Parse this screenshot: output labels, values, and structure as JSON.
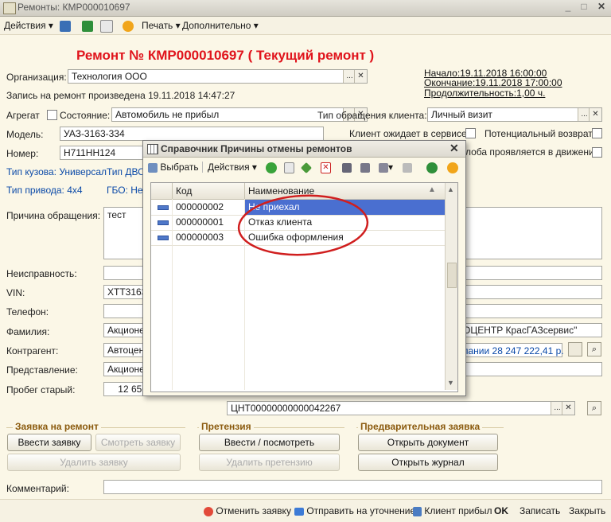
{
  "window": {
    "title": "Ремонты: КМР000010697"
  },
  "toolbar": {
    "actions": "Действия",
    "print": "Печать",
    "more": "Дополнительно"
  },
  "header": {
    "title": "Ремонт № КМР000010697 ( Текущий ремонт )"
  },
  "org": {
    "label": "Организация:",
    "value": "Технология ООО"
  },
  "record_text": "Запись на ремонт произведена 19.11.2018 14:47:27",
  "period": {
    "start": "Начало:19.11.2018 16:00:00",
    "end": "Окончание:19.11.2018 17:00:00",
    "duration": "Продолжительность:1,00 ч."
  },
  "aggregate": {
    "label": "Агрегат",
    "state_label": "Состояние:",
    "state_value": "Автомобиль не прибыл"
  },
  "client_type": {
    "label": "Тип обращения клиента:",
    "value": "Личный визит"
  },
  "model": {
    "label": "Модель:",
    "value": "УАЗ-3163-334"
  },
  "waiting": {
    "label": "Клиент ожидает в сервисе",
    "potential_return": "Потенциальный возврат",
    "in_motion": "лоба проявляется в движении"
  },
  "number": {
    "label": "Номер:",
    "value": "Н711НН124"
  },
  "body_type": "Тип кузова: Универсал",
  "engine_type": "Тип ДВС",
  "drive_type": "Тип привода: 4х4",
  "gbo": "ГБО: Нет",
  "reason": {
    "label": "Причина обращения:",
    "value": "тест"
  },
  "fault": {
    "label": "Неисправность:"
  },
  "vin": {
    "label": "VIN:",
    "value": "XTT3163"
  },
  "phone": {
    "label": "Телефон:"
  },
  "surname": {
    "label": "Фамилия:",
    "value": "Акционер",
    "right_value": "ОЦЕНТР КрасГАЗсервис\""
  },
  "counterparty": {
    "label": "Контрагент:",
    "value": "Автоцент",
    "right_link": "пании 28 247 222,41 р."
  },
  "representation": {
    "label": "Представление:",
    "value": "Акционер"
  },
  "mileage": {
    "label": "Пробег старый:",
    "value": "12 650"
  },
  "code_field": "ЦНТ00000000000042267",
  "groups": {
    "request": {
      "title": "Заявка на ремонт",
      "enter": "Ввести заявку",
      "view": "Смотреть заявку",
      "delete": "Удалить заявку"
    },
    "claim": {
      "title": "Претензия",
      "enter": "Ввести / посмотреть претензию",
      "delete": "Удалить претензию"
    },
    "prelim": {
      "title": "Предварительная заявка",
      "open_doc": "Открыть документ",
      "open_journal": "Открыть журнал"
    }
  },
  "comment": {
    "label": "Комментарий:"
  },
  "bottom": {
    "cancel": "Отменить заявку",
    "send": "Отправить на уточнение",
    "arrived": "Клиент прибыл",
    "ok": "OK",
    "save": "Записать",
    "close": "Закрыть"
  },
  "dialog": {
    "title": "Справочник Причины отмены ремонтов",
    "select": "Выбрать",
    "actions": "Действия",
    "columns": {
      "code": "Код",
      "name": "Наименование"
    },
    "rows": [
      {
        "code": "000000002",
        "name": "Не приехал"
      },
      {
        "code": "000000001",
        "name": "Отказ клиента"
      },
      {
        "code": "000000003",
        "name": "Ошибка оформления"
      }
    ]
  },
  "colors": {
    "title_red": "#e0141c",
    "selection": "#4a6fd0",
    "link_blue": "#0a49a8",
    "ellipse_red": "#d01e1e"
  }
}
